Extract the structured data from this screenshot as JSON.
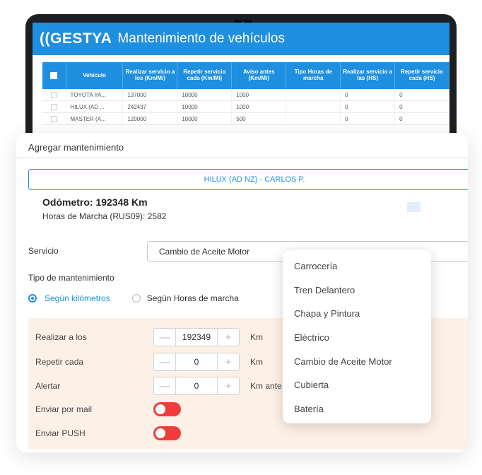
{
  "app": {
    "logo": "((GESTYA",
    "title": "Mantenimiento de vehículos"
  },
  "grid": {
    "headers": [
      "Vehículo",
      "Realizar servicio a los (Km/Mi)",
      "Repetir servicio cada (Km/Mi)",
      "Aviso antes (Km/Mi)",
      "Tipo Horas de marcha",
      "Realizar servicio a las (HS)",
      "Repetir servicio cada (HS)"
    ],
    "rows": [
      [
        "TOYOTA YA...",
        "137000",
        "10000",
        "1000",
        "",
        "0",
        "0"
      ],
      [
        "HILUX (AD ...",
        "242437",
        "10000",
        "1000",
        "",
        "0",
        "0"
      ],
      [
        "MASTER (A...",
        "120000",
        "10000",
        "500",
        "",
        "0",
        "0"
      ]
    ]
  },
  "modal": {
    "title": "Agregar mantenimiento",
    "vehicle": "HILUX (AD NZ) - CARLOS P.",
    "odometer": "Odómetro: 192348 Km",
    "hours": "Horas de Marcha (RUS09): 2582",
    "service_label": "Servicio",
    "service_value": "Cambio de Aceite Motor",
    "type_label": "Tipo de mantenimiento",
    "radio_km": "Según kilómetros",
    "radio_hours": "Según Horas de marcha",
    "fields": {
      "realizar": {
        "label": "Realizar a los",
        "value": "192349",
        "unit": "Km"
      },
      "repetir": {
        "label": "Repetir cada",
        "value": "0",
        "unit": "Km"
      },
      "alertar": {
        "label": "Alertar",
        "value": "0",
        "unit": "Km ante"
      }
    },
    "mail_label": "Enviar por mail",
    "push_label": "Enviar PUSH",
    "minus": "—",
    "plus": "+"
  },
  "dropdown": {
    "options": [
      "Carrocería",
      "Tren Delantero",
      "Chapa y Pintura",
      "Eléctrico",
      "Cambio de Aceite Motor",
      "Cubierta",
      "Batería"
    ]
  },
  "colors": {
    "accent": "#1f8fe0",
    "toggle": "#f23b3b",
    "form_bg": "#fdf1e7"
  }
}
